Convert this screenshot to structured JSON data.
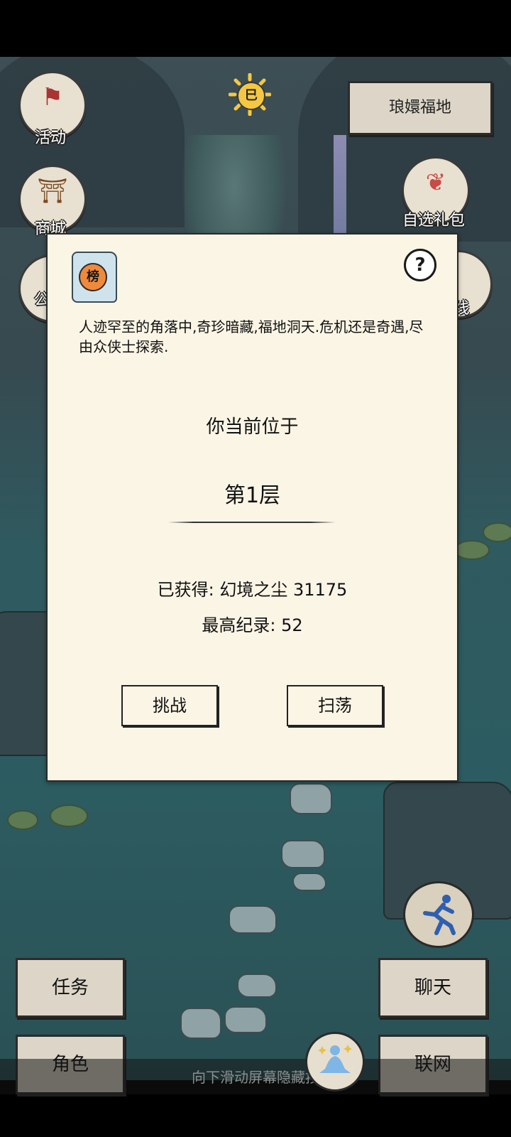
{
  "top_icons": {
    "activity_label": "活动",
    "shop_label": "商城",
    "announce_label": "公",
    "gift_label": "自选礼包",
    "right_partial_label": "线",
    "sun_char": "巳"
  },
  "location": {
    "name": "琅嬛福地"
  },
  "dialog": {
    "rank_char": "榜",
    "help_char": "?",
    "description": "人迹罕至的角落中,奇珍暗藏,福地洞天.危机还是奇遇,尽由众侠士探索.",
    "current_label": "你当前位于",
    "floor": "第1层",
    "obtained": "已获得: 幻境之尘 31175",
    "record": "最高纪录: 52",
    "challenge_label": "挑战",
    "sweep_label": "扫荡"
  },
  "bottom_buttons": {
    "task": "任务",
    "role": "角色",
    "chat": "聊天",
    "network": "联网"
  },
  "hint": "向下滑动屏幕隐藏按",
  "colors": {
    "dialog_bg": "#fbf5e6",
    "scene": "#2f5a5f",
    "seal": "#f08a3b"
  }
}
